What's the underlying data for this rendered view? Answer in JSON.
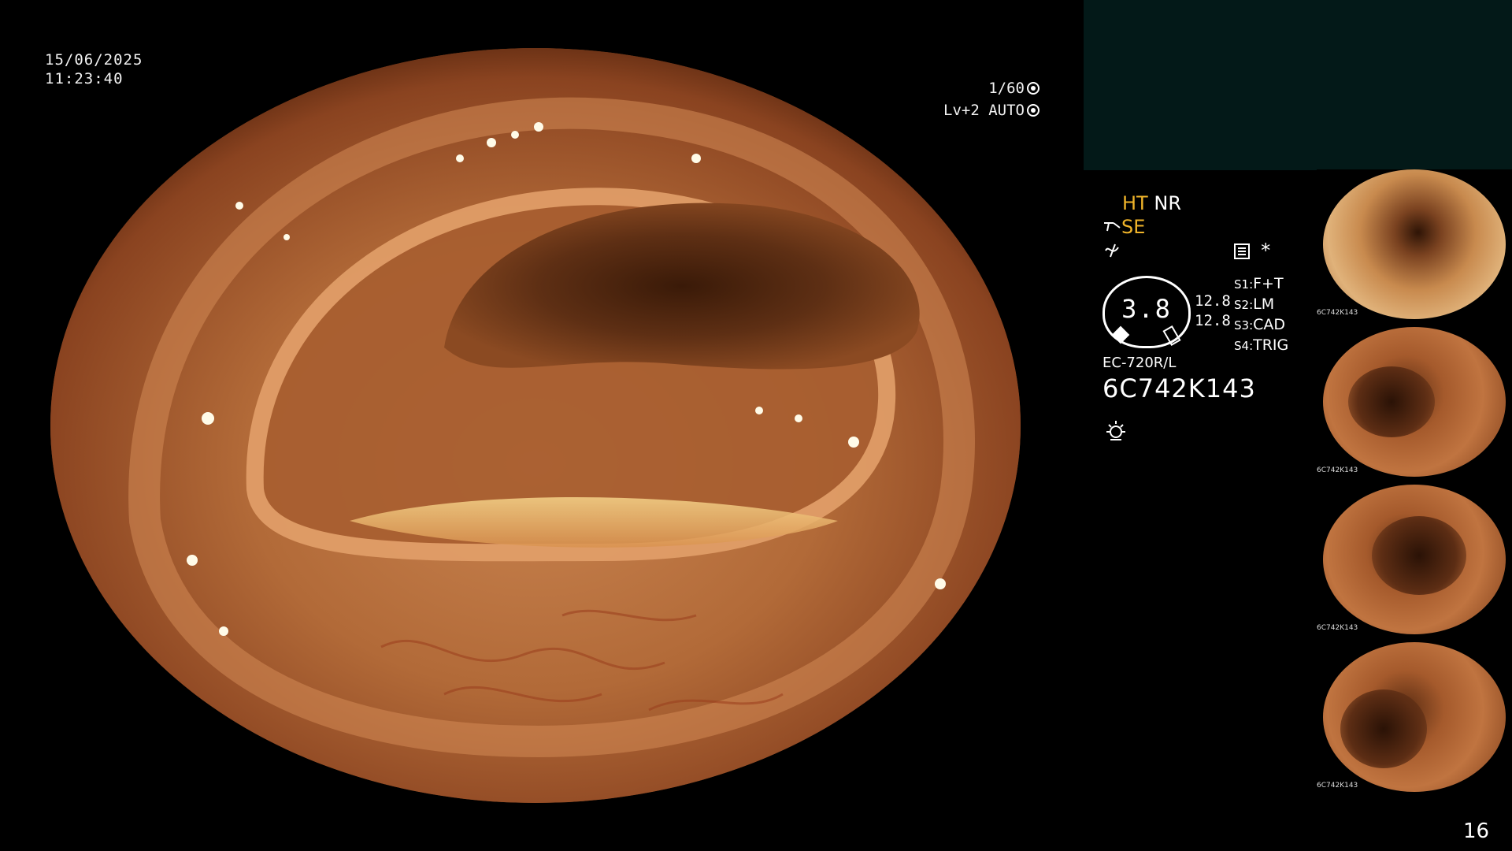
{
  "overlay": {
    "date": "15/06/2025",
    "time": "11:23:40",
    "shutter": "1/60",
    "level": "Lv+2 AUTO",
    "shutter_icon": "shutter-icon",
    "auto_icon": "auto-iris-icon"
  },
  "panel": {
    "ht_label": "HT",
    "nr_label": "NR",
    "se_label": "SE",
    "enhance_icon": "structure-enhance-icon",
    "filter_icon": "filter-icon",
    "menu_icon": "menu-icon",
    "asterisk": "*",
    "gauge_value": "3.8",
    "gauge_side_top": "12.8",
    "gauge_side_bottom": "12.8",
    "switches": [
      {
        "key": "S1:",
        "value": "F+T"
      },
      {
        "key": "S2:",
        "value": "LM"
      },
      {
        "key": "S3:",
        "value": "CAD"
      },
      {
        "key": "S4:",
        "value": "TRIG"
      }
    ],
    "scope_model": "EC-720R/L",
    "serial": "6C742K143",
    "light_icon": "light-source-icon"
  },
  "thumbnails": [
    {
      "caption": "6C742K143"
    },
    {
      "caption": "6C742K143"
    },
    {
      "caption": "6C742K143"
    },
    {
      "caption": "6C742K143"
    }
  ],
  "page_number": "16",
  "colors": {
    "accent": "#f0b42a",
    "panel_teal": "#031918",
    "background": "#000000"
  }
}
